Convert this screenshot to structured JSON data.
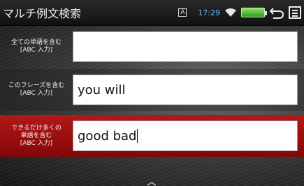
{
  "app": {
    "title": "マルチ例文検索"
  },
  "status": {
    "keyboard_indicator": "A",
    "time": "17:29",
    "icons": [
      "keyboard-mode-icon",
      "wifi-icon",
      "battery-icon",
      "back-icon",
      "menu-icon"
    ]
  },
  "fields": [
    {
      "label_line1": "全ての単語を含む",
      "label_line2": "[ABC 入力]",
      "value": ""
    },
    {
      "label_line1": "このフレーズを含む",
      "label_line2": "[ABC 入力]",
      "value": "you will"
    },
    {
      "label_line1": "できるだけ多くの",
      "label_line2": "単語を含む",
      "label_line3": "[ABC 入力]",
      "value": "good bad"
    }
  ],
  "colors": {
    "active_row": "#a10f0f",
    "time": "#5ec2ff",
    "background": "#2a2a2a"
  }
}
